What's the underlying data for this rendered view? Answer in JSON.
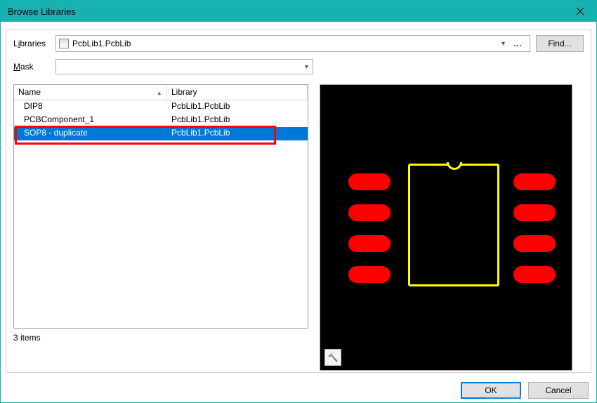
{
  "window": {
    "title": "Browse Libraries"
  },
  "labels": {
    "libraries_pre": "L",
    "libraries_u": "i",
    "libraries_post": "braries",
    "mask_u": "M",
    "mask_post": "ask",
    "find": "Find...",
    "items": "3 items",
    "ok": "OK",
    "cancel": "Cancel"
  },
  "library_dropdown": {
    "value": "PcbLib1.PcbLib"
  },
  "mask": {
    "value": ""
  },
  "columns": {
    "name": "Name",
    "library": "Library"
  },
  "rows": [
    {
      "name": "DIP8",
      "library": "PcbLib1.PcbLib",
      "selected": false
    },
    {
      "name": "PCBComponent_1",
      "library": "PcbLib1.PcbLib",
      "selected": false
    },
    {
      "name": "SOP8 - duplicate",
      "library": "PcbLib1.PcbLib",
      "selected": true
    }
  ],
  "preview": {
    "pads_left_y": [
      126,
      170,
      214,
      258
    ],
    "pads_right_y": [
      126,
      170,
      214,
      258
    ]
  },
  "watermark": "https://blog.csdn.net/heli12580"
}
